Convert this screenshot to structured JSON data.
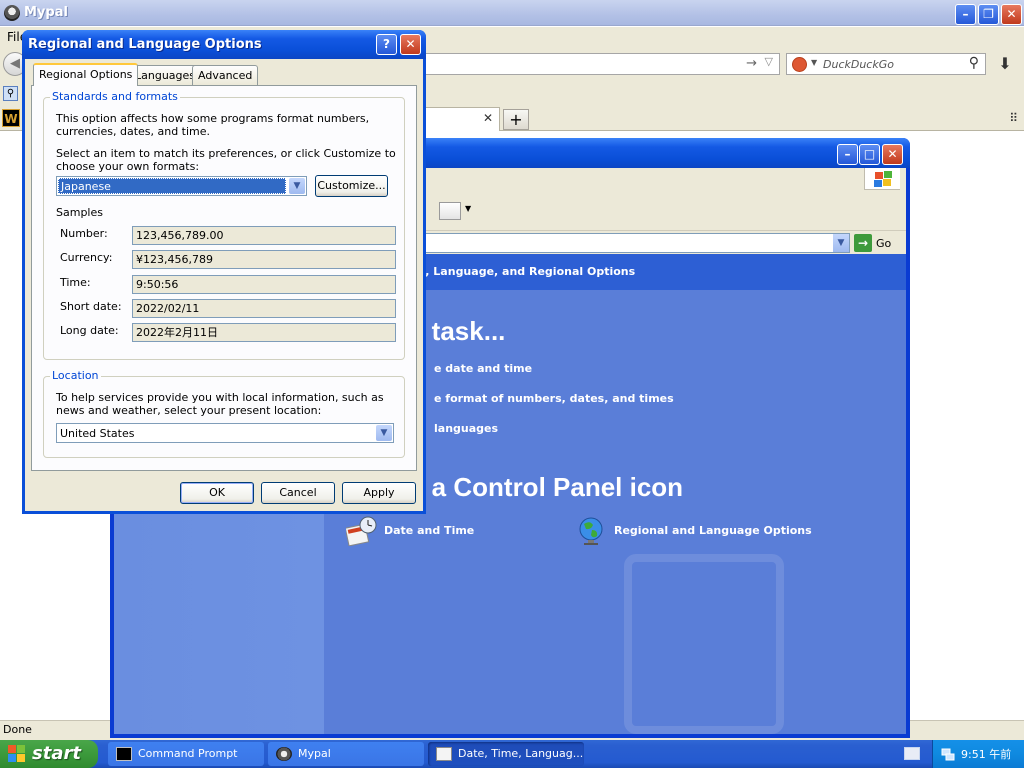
{
  "browser": {
    "title": "Mypal",
    "menu_file": "File",
    "search_placeholder": "DuckDuckGo",
    "status": "Done"
  },
  "control_panel": {
    "header": "ne, Language, and Regional Options",
    "pick_task": "a task...",
    "tasks": [
      "e date and time",
      "e format of numbers, dates, and times",
      "languages"
    ],
    "pick_icon": "k a Control Panel icon",
    "icons": [
      {
        "label": "Date and Time",
        "icon": "calendar-clock-icon"
      },
      {
        "label": "Regional and Language Options",
        "icon": "globe-icon"
      }
    ],
    "go_label": "Go"
  },
  "dialog": {
    "title": "Regional and Language Options",
    "tabs": [
      "Regional Options",
      "Languages",
      "Advanced"
    ],
    "standards": {
      "group_label": "Standards and formats",
      "intro": "This option affects how some programs format numbers, currencies, dates, and time.",
      "instruction": "Select an item to match its preferences, or click Customize to choose your own formats:",
      "selected_locale": "Japanese",
      "customize_label": "Customize...",
      "samples_heading": "Samples",
      "samples": [
        {
          "label": "Number:",
          "value": "123,456,789.00"
        },
        {
          "label": "Currency:",
          "value": "¥123,456,789"
        },
        {
          "label": "Time:",
          "value": "9:50:56"
        },
        {
          "label": "Short date:",
          "value": "2022/02/11"
        },
        {
          "label": "Long date:",
          "value": "2022年2月11日"
        }
      ]
    },
    "location": {
      "group_label": "Location",
      "text": "To help services provide you with local information, such as news and weather, select your present location:",
      "selected": "United States"
    },
    "buttons": {
      "ok": "OK",
      "cancel": "Cancel",
      "apply": "Apply"
    }
  },
  "taskbar": {
    "start_label": "start",
    "items": [
      {
        "label": "Command Prompt",
        "active": false
      },
      {
        "label": "Mypal",
        "active": false
      },
      {
        "label": "Date, Time, Languag...",
        "active": true
      }
    ],
    "clock": "9:51 午前"
  }
}
